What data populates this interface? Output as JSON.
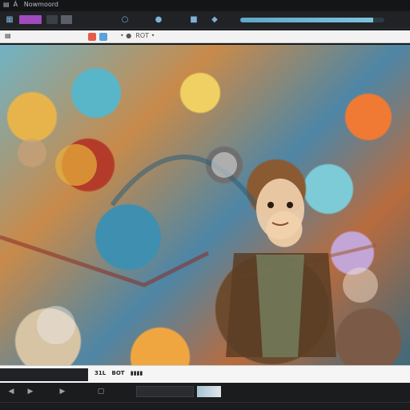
{
  "window": {
    "title": "▤  Á   Nowmoord"
  },
  "toolbar": {
    "buttons": [
      {
        "name": "toolbar-swatch-1",
        "color": "#a04bbd"
      },
      {
        "name": "toolbar-swatch-2",
        "color": "#3b3f46"
      },
      {
        "name": "toolbar-swatch-3",
        "color": "#5b6068"
      }
    ],
    "icons": [
      "mode-icon",
      "brush-icon",
      "layers-icon",
      "filter-icon",
      "settings-icon"
    ],
    "progress": 0.92
  },
  "tabs": {
    "label": "▤    ",
    "crumb": "• ●  ROT •  "
  },
  "status": {
    "text": "31L   BOT   ▮▮▮▮"
  },
  "bottombar": {
    "icons": [
      "back-icon",
      "play-icon",
      "forward-icon",
      "frame-icon"
    ]
  }
}
